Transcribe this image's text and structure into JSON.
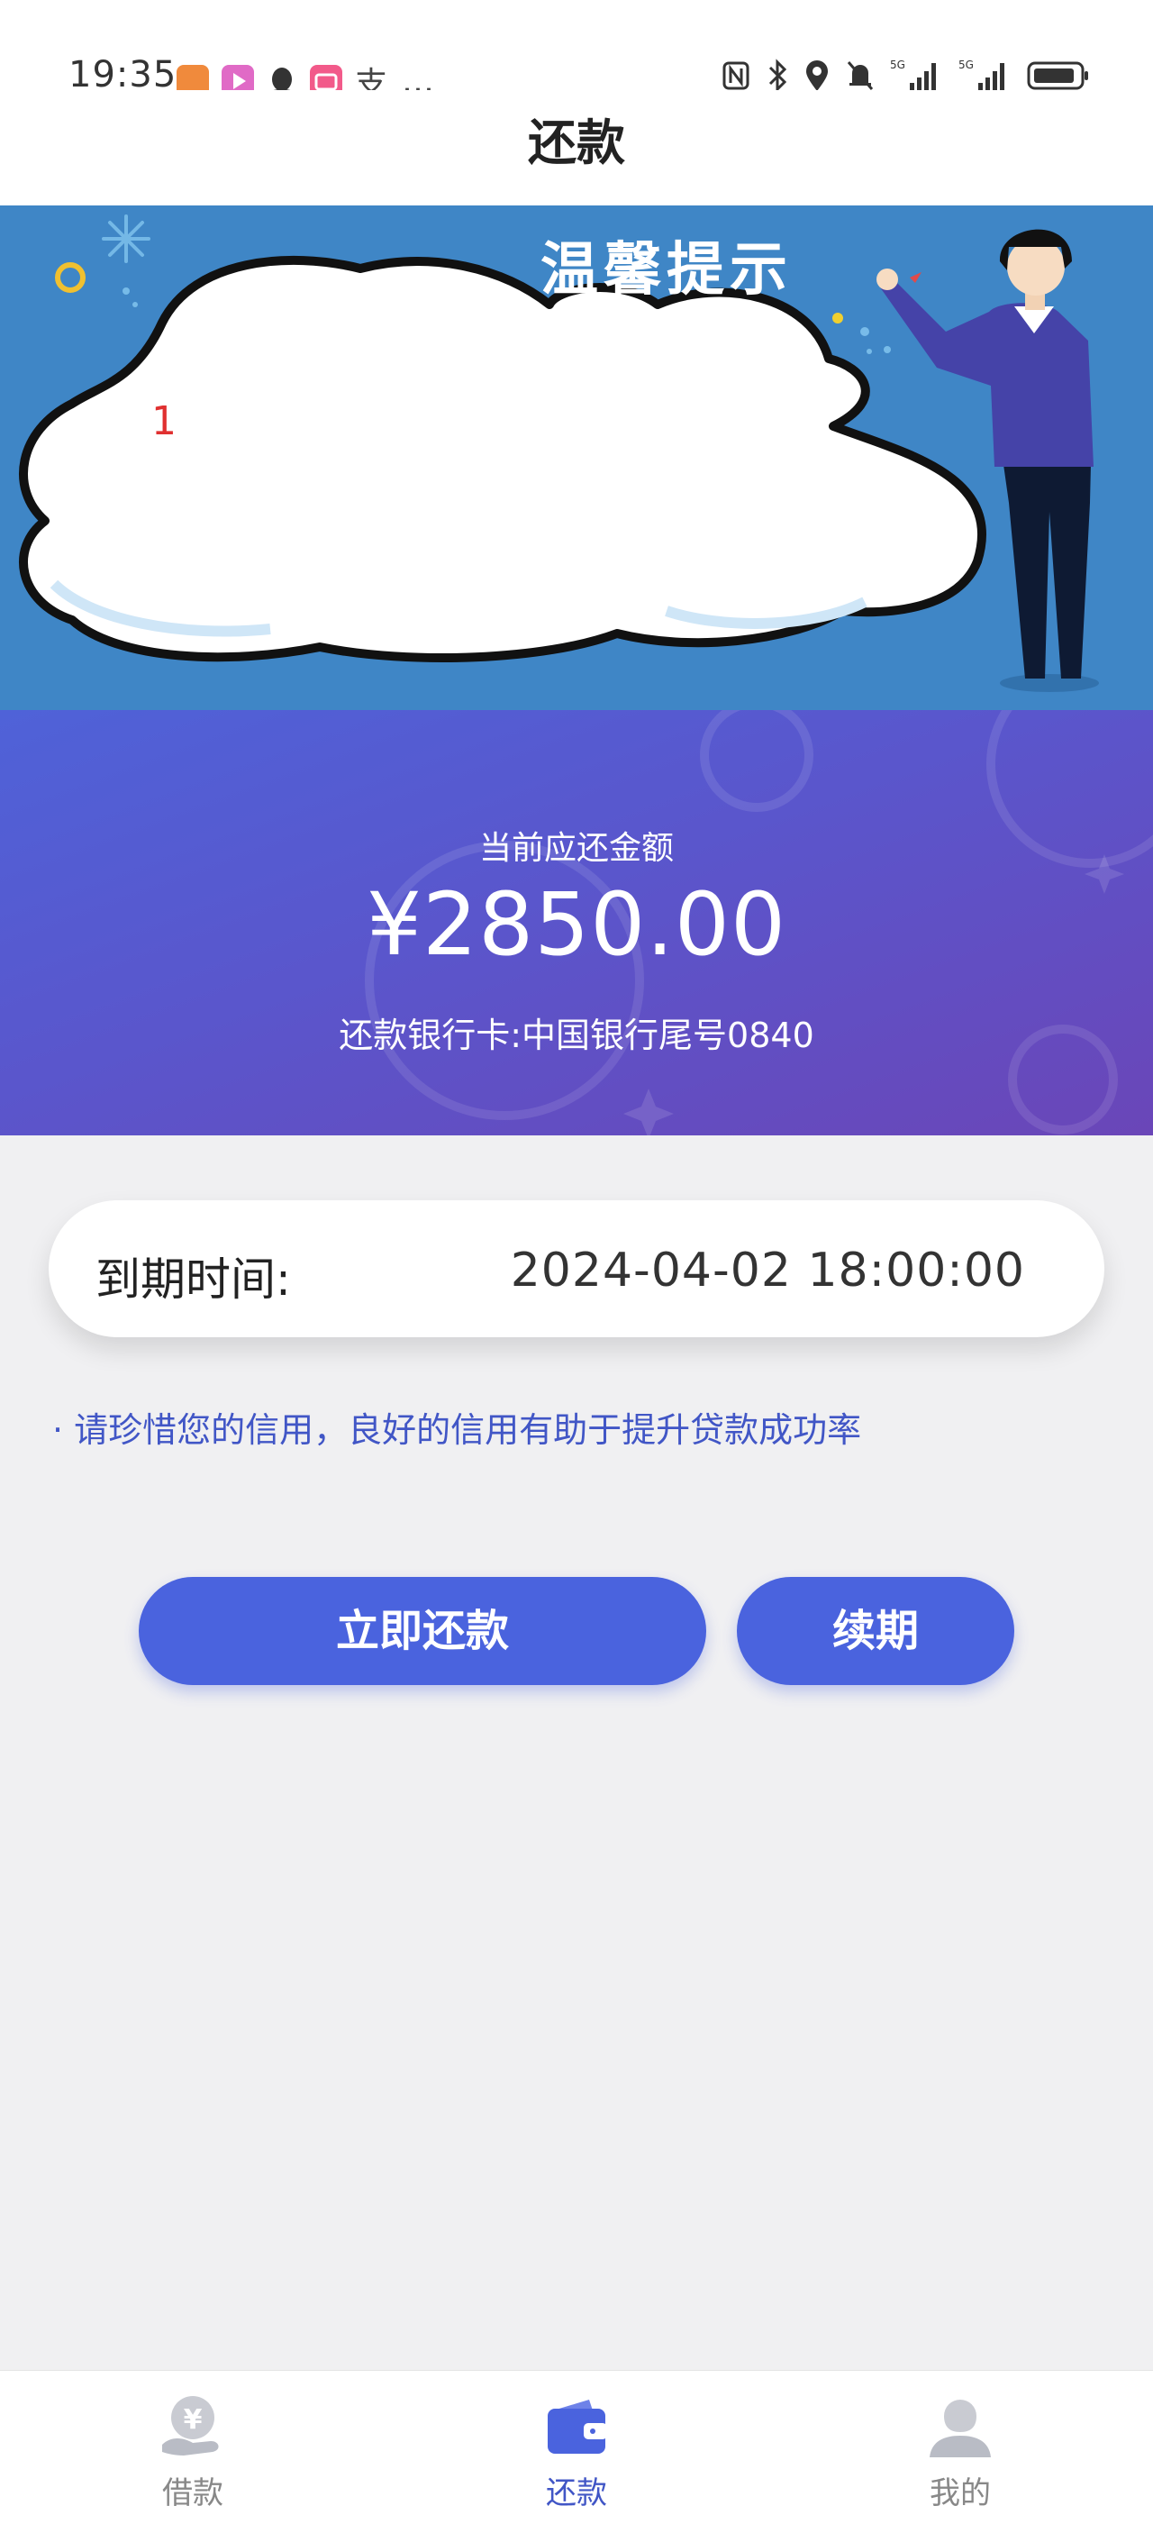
{
  "status_bar": {
    "time": "19:35",
    "extra": "…",
    "zhi": "支",
    "icons": [
      "app-icon-orange",
      "video-app-icon",
      "qq-penguin-icon",
      "bilibili-icon",
      "alipay-icon",
      "nfc-icon",
      "bluetooth-icon",
      "location-icon",
      "mute-bell-icon",
      "signal-5g-icon",
      "signal-5g-icon",
      "battery-icon"
    ]
  },
  "header": {
    "title": "还款"
  },
  "banner": {
    "title": "温馨提示",
    "note": "1"
  },
  "repayment": {
    "amount_label": "当前应还金额",
    "amount": "¥2850.00",
    "bank_card": "还款银行卡:中国银行尾号0840"
  },
  "due": {
    "label": "到期时间:",
    "value": "2024-04-02 18:00:00"
  },
  "tip": "· 请珍惜您的信用，良好的信用有助于提升贷款成功率",
  "buttons": {
    "repay": "立即还款",
    "renew": "续期"
  },
  "tabbar": {
    "items": [
      {
        "label": "借款",
        "icon": "loan-hand-icon",
        "active": false
      },
      {
        "label": "还款",
        "icon": "wallet-icon",
        "active": true
      },
      {
        "label": "我的",
        "icon": "profile-icon",
        "active": false
      }
    ]
  },
  "colors": {
    "accent": "#4a63de",
    "tip_text": "#4156c6",
    "banner_blue": "#3f86c6",
    "panel_purple": "#5a56cc",
    "note_red": "#e03030"
  }
}
